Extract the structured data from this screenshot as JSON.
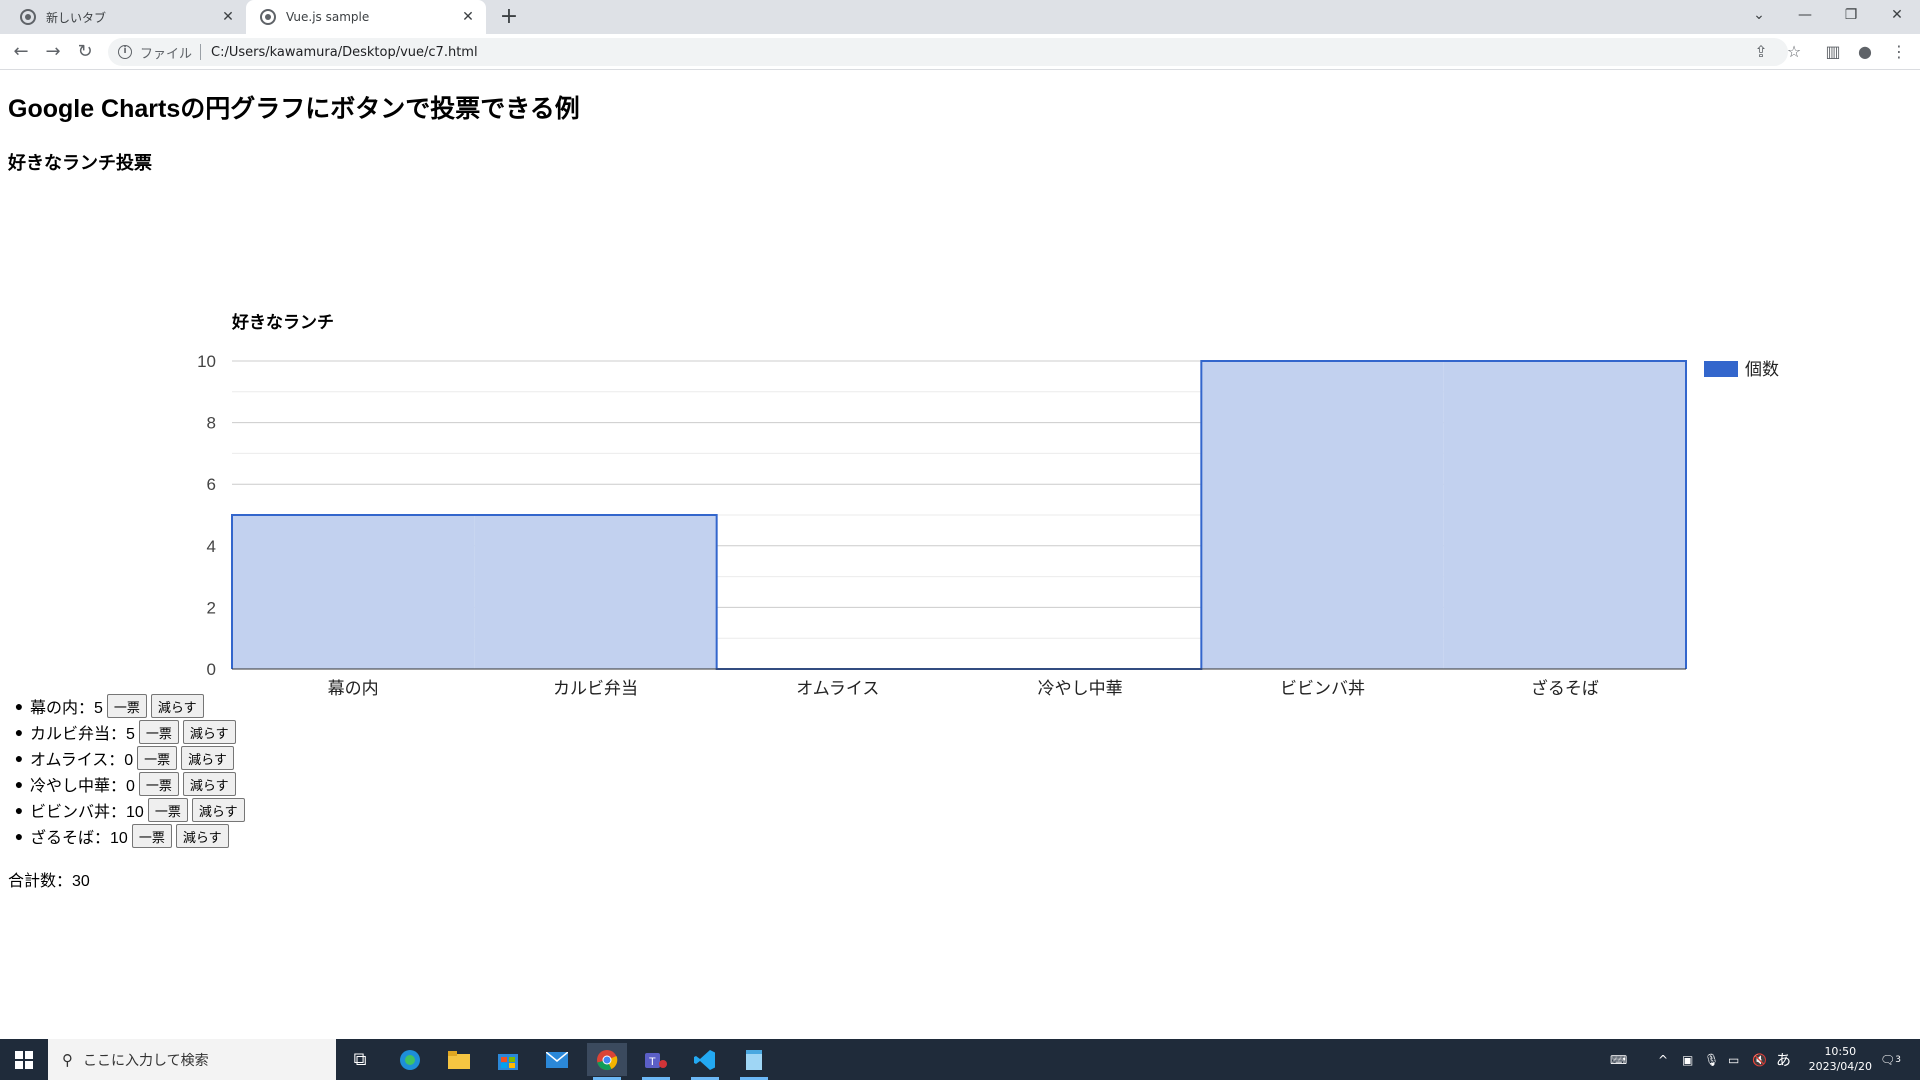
{
  "browser": {
    "tabs": [
      {
        "title": "新しいタブ",
        "close": "✕"
      },
      {
        "title": "Vue.js sample",
        "close": "✕"
      }
    ],
    "new_tab": "+",
    "address": {
      "scheme": "ファイル",
      "path": "C:/Users/kawamura/Desktop/vue/c7.html"
    }
  },
  "page": {
    "title": "Google Chartsの円グラフにボタンで投票できる例",
    "subtitle": "好きなランチ投票",
    "vote_button": "一票",
    "decrease_button": "減らす",
    "items": [
      {
        "label": "幕の内：5",
        "count": "5"
      },
      {
        "label": "カルビ弁当：5",
        "count": "5"
      },
      {
        "label": "オムライス：0",
        "count": "0"
      },
      {
        "label": "冷やし中華：0",
        "count": "0"
      },
      {
        "label": "ビビンバ丼：10",
        "count": "10"
      },
      {
        "label": "ざるそば：10",
        "count": "10"
      }
    ],
    "total": "合計数：30"
  },
  "chart_data": {
    "type": "area",
    "title": "好きなランチ",
    "categories": [
      "幕の内",
      "カルビ弁当",
      "オムライス",
      "冷やし中華",
      "ビビンバ丼",
      "ざるそば"
    ],
    "series": [
      {
        "name": "個数",
        "values": [
          5,
          5,
          0,
          0,
          10,
          10
        ]
      }
    ],
    "ylim": [
      0,
      10
    ],
    "yticks": [
      "0",
      "2",
      "4",
      "6",
      "8",
      "10"
    ],
    "grid": true,
    "legend": "right",
    "color": "#3366cc",
    "fill_color": "#c2d1ef"
  },
  "taskbar": {
    "search_placeholder": "ここに入力して検索",
    "time": "10:50",
    "date": "2023/04/20",
    "ime": "あ",
    "notifications": "3"
  }
}
